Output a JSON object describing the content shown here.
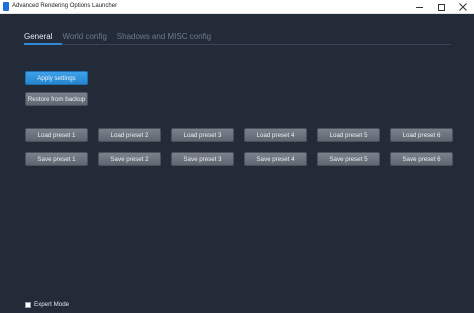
{
  "window": {
    "title": "Advanced Rendering Options Launcher",
    "icon": "app-icon"
  },
  "tabs": [
    {
      "label": "General",
      "active": true
    },
    {
      "label": "World config",
      "active": false
    },
    {
      "label": "Shadows and MISC config",
      "active": false
    }
  ],
  "actions": {
    "apply_label": "Apply settings",
    "restore_label": "Restore from backup"
  },
  "presets": {
    "load": [
      "Load preset 1",
      "Load preset 2",
      "Load preset 3",
      "Load preset 4",
      "Load preset 5",
      "Load preset 6"
    ],
    "save": [
      "Save preset 1",
      "Save preset 2",
      "Save preset 3",
      "Save preset 4",
      "Save preset 5",
      "Save preset 6"
    ]
  },
  "expert_mode": {
    "label": "Expert Mode",
    "checked": false
  },
  "colors": {
    "background": "#232b38",
    "accent": "#2e8ad8",
    "button": "#6b727c"
  }
}
